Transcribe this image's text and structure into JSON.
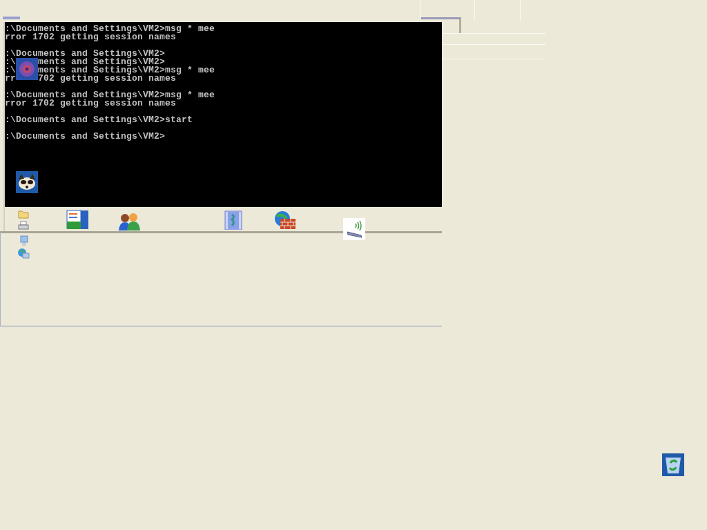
{
  "console": {
    "lines": [
      {
        "kind": "text",
        "text": ":\\Documents and Settings\\VM2>msg * mee"
      },
      {
        "kind": "text",
        "text": "rror 1702 getting session names"
      },
      {
        "kind": "blank"
      },
      {
        "kind": "text",
        "text": ":\\Documents and Settings\\VM2>"
      },
      {
        "kind": "split",
        "left": ":\\",
        "right": "ments and Settings\\VM2>"
      },
      {
        "kind": "split",
        "left": ":\\",
        "right": "ments and Settings\\VM2>msg * mee"
      },
      {
        "kind": "split",
        "left": "rr",
        "right": "702 getting session names"
      },
      {
        "kind": "blank"
      },
      {
        "kind": "text",
        "text": ":\\Documents and Settings\\VM2>msg * mee"
      },
      {
        "kind": "text",
        "text": "rror 1702 getting session names"
      },
      {
        "kind": "blank"
      },
      {
        "kind": "text",
        "text": ":\\Documents and Settings\\VM2>start"
      },
      {
        "kind": "blank"
      },
      {
        "kind": "text",
        "text": ":\\Documents and Settings\\VM2>"
      }
    ]
  }
}
